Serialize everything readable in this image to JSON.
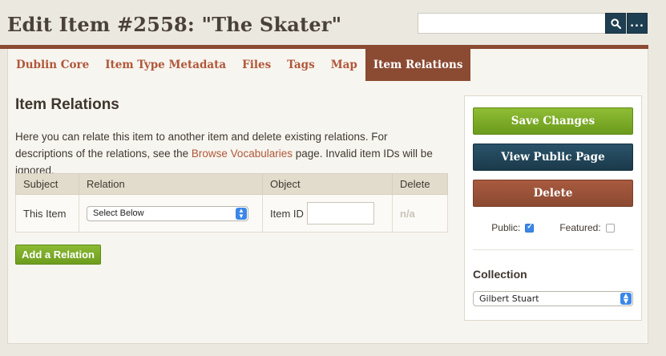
{
  "header": {
    "title": "Edit Item #2558: \"The Skater\"",
    "search": {
      "value": "",
      "placeholder": ""
    },
    "search_icon": "search-icon",
    "advanced_label": "..."
  },
  "tabs": [
    {
      "label": "Dublin Core",
      "active": false
    },
    {
      "label": "Item Type Metadata",
      "active": false
    },
    {
      "label": "Files",
      "active": false
    },
    {
      "label": "Tags",
      "active": false
    },
    {
      "label": "Map",
      "active": false
    },
    {
      "label": "Item Relations",
      "active": true
    }
  ],
  "main": {
    "section_title": "Item Relations",
    "description_1": "Here you can relate this item to another item and delete existing relations. For descriptions of the relations, see the",
    "description_link": "Browse Vocabularies",
    "description_2": "page. Invalid item IDs will be ignored.",
    "table": {
      "headers": [
        "Subject",
        "Relation",
        "Object",
        "Delete"
      ],
      "row": {
        "subject": "This Item",
        "relation_selected": "Select Below",
        "object_label": "Item ID",
        "object_value": "",
        "delete": "n/a"
      }
    },
    "add_button": "Add a Relation"
  },
  "sidebar": {
    "save": "Save Changes",
    "view_public": "View Public Page",
    "delete": "Delete",
    "public_label": "Public:",
    "public_checked": true,
    "featured_label": "Featured:",
    "featured_checked": false,
    "collection_label": "Collection",
    "collection_selected": "Gilbert Stuart"
  },
  "colors": {
    "accent": "#8b4a32",
    "link": "#b0573a",
    "green": "#7aab27",
    "navy": "#1e3f52",
    "checkbox_blue": "#3b87e8"
  }
}
